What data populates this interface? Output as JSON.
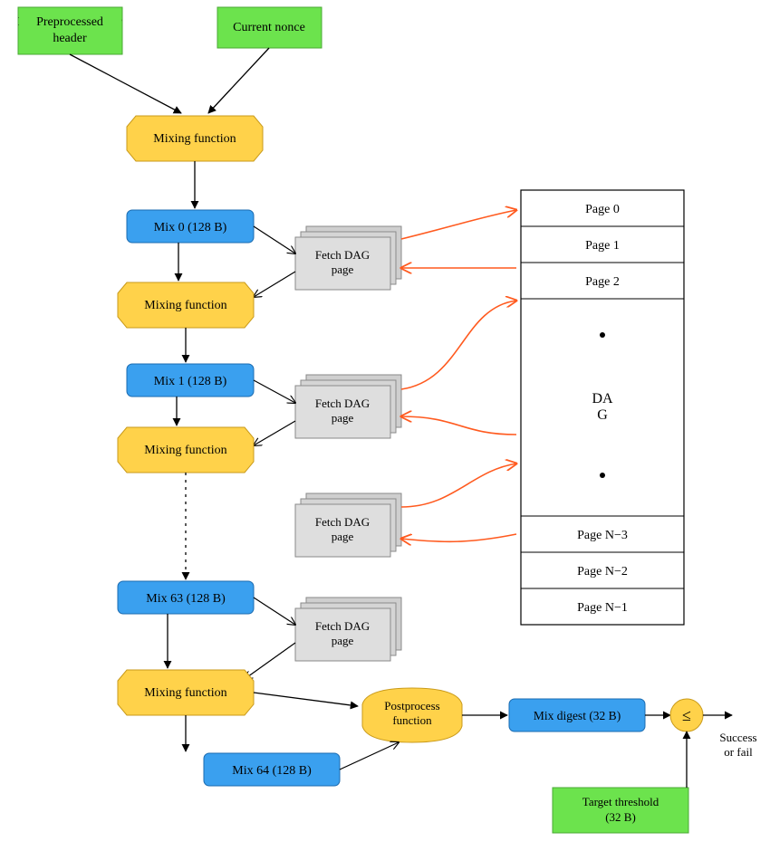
{
  "inputs": {
    "preprocessed_header": "Preprocessed header",
    "current_nonce": "Current nonce"
  },
  "mixing": {
    "top": "Mixing function",
    "mix0": "Mix 0 (128 B)",
    "fn0": "Mixing function",
    "mix1": "Mix 1 (128 B)",
    "fn1": "Mixing function",
    "mix63": "Mix 63 (128 B)",
    "fnlast": "Mixing function",
    "mix64": "Mix 64 (128 B)"
  },
  "fetch": "Fetch DAG page",
  "postprocess": "Postprocess function",
  "mix_digest": "Mix digest (32 B)",
  "cmp": "≤",
  "result": "Success or fail",
  "target": "Target threshold (32 B)",
  "dag": {
    "label": "DAG",
    "pages": {
      "p0": "Page 0",
      "p1": "Page 1",
      "p2": "Page 2",
      "pN3": "Page N−3",
      "pN2": "Page N−2",
      "pN1": "Page N−1"
    }
  }
}
